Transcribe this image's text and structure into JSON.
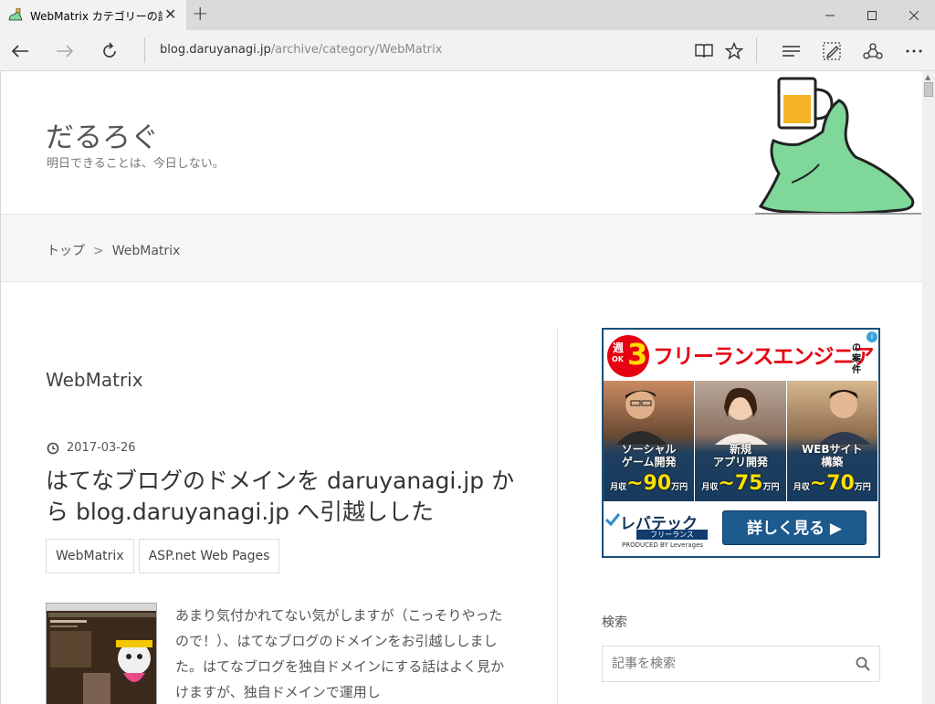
{
  "browser": {
    "tab_title": "WebMatrix カテゴリーの記",
    "address_host": "blog.daruyanagi.jp",
    "address_path": "/archive/category/WebMatrix"
  },
  "site": {
    "title": "だるろぐ",
    "description": "明日できることは、今日しない。"
  },
  "breadcrumb": {
    "home": "トップ",
    "separator": ">",
    "current": "WebMatrix"
  },
  "main": {
    "archive_title": "WebMatrix",
    "entry": {
      "date": "2017-03-26",
      "title": "はてなブログのドメインを daruyanagi.jp から blog.daruyanagi.jp へ引越しした",
      "categories": [
        "WebMatrix",
        "ASP.net Web Pages"
      ],
      "excerpt": "あまり気付かれてない気がしますが（こっそりやったので！）、はてなブログのドメインをお引越ししました。はてなブログを独自ドメインにする話はよく見かけますが、独自ドメインで運用し"
    }
  },
  "sidebar": {
    "ad": {
      "week_char": "週",
      "week_ok": "OK",
      "week_number": "3",
      "headline": "フリーランスエンジニア",
      "case_text": "の案件",
      "info": "i",
      "panels": [
        {
          "line1": "ソーシャル",
          "line2": "ゲーム開発",
          "salary_prefix": "月収",
          "salary": "~90",
          "unit": "万円"
        },
        {
          "line1": "新規",
          "line2": "アプリ開発",
          "salary_prefix": "月収",
          "salary": "~75",
          "unit": "万円"
        },
        {
          "line1": "WEBサイト",
          "line2": "構築",
          "salary_prefix": "月収",
          "salary": "~70",
          "unit": "万円"
        }
      ],
      "brand": "レバテック",
      "brand_sub": "フリーランス",
      "brand_by": "PRODUCED BY Leverages",
      "cta": "詳しく見る ▶"
    },
    "search": {
      "title": "検索",
      "placeholder": "記事を検索"
    }
  },
  "colors": {
    "ad_red": "#e60012",
    "ad_navy": "#1d5a8e",
    "mascot_green": "#7fd89a"
  }
}
